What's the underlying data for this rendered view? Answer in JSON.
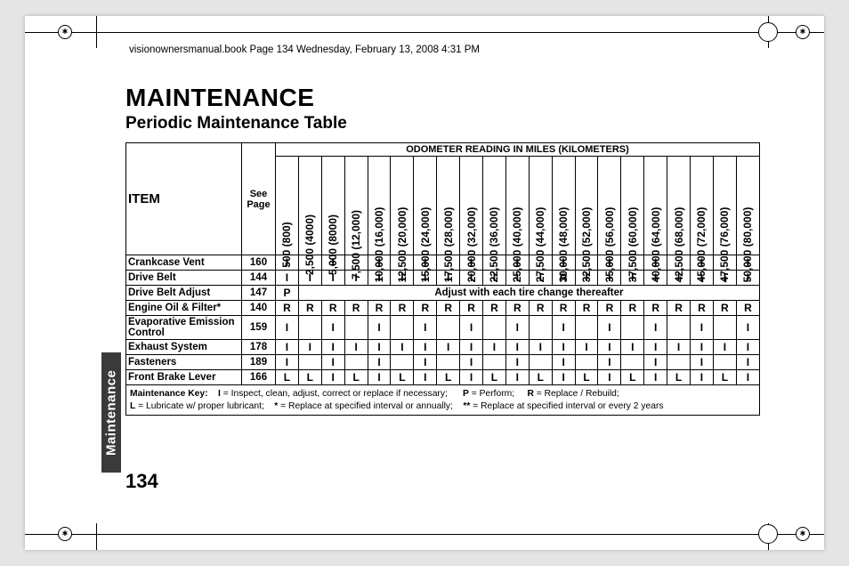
{
  "meta": {
    "header": "visionownersmanual.book  Page 134  Wednesday, February 13, 2008  4:31 PM"
  },
  "title": "MAINTENANCE",
  "subtitle": "Periodic Maintenance Table",
  "side_tab": "Maintenance",
  "page_number": "134",
  "table": {
    "item_head": "ITEM",
    "page_head": "See Page",
    "odometer_head": "ODOMETER READING IN MILES (KILOMETERS)",
    "columns": [
      "500 (800)",
      "2,500 (4000)",
      "5,000 (8000)",
      "7,500 (12,000)",
      "10,000 (16,000)",
      "12,500 (20,000)",
      "15,000 (24,000)",
      "17,500 (28,000)",
      "20,000 (32,000)",
      "22,500 (36,000)",
      "25,000 (40,000)",
      "27,500 (44,000)",
      "30,000 (48,000)",
      "32,500 (52,000)",
      "35,000 (56,000)",
      "37,500 (60,000)",
      "40,000 (64,000)",
      "42,500 (68,000)",
      "45,000 (72,000)",
      "47,500 (76,000)",
      "50,000 (80,000)"
    ],
    "rows": [
      {
        "name": "Crankcase Vent",
        "page": "160",
        "v": [
          "I",
          "",
          "I",
          "",
          "I",
          "",
          "I",
          "",
          "I",
          "",
          "I",
          "",
          "I",
          "",
          "I",
          "",
          "I",
          "",
          "I",
          "",
          "I"
        ]
      },
      {
        "name": "Drive Belt",
        "page": "144",
        "v": [
          "I",
          "I",
          "I",
          "I",
          "I",
          "I",
          "I",
          "I",
          "I",
          "I",
          "I",
          "I",
          "R",
          "I",
          "I",
          "I",
          "I",
          "I",
          "I",
          "I",
          "I"
        ]
      },
      {
        "name": "Drive Belt Adjust",
        "page": "147",
        "adjust_first": "P",
        "adjust_text": "Adjust with each tire change thereafter"
      },
      {
        "name": "Engine Oil & Filter*",
        "page": "140",
        "v": [
          "R",
          "R",
          "R",
          "R",
          "R",
          "R",
          "R",
          "R",
          "R",
          "R",
          "R",
          "R",
          "R",
          "R",
          "R",
          "R",
          "R",
          "R",
          "R",
          "R",
          "R"
        ]
      },
      {
        "name": "Evaporative Emission Control",
        "page": "159",
        "v": [
          "I",
          "",
          "I",
          "",
          "I",
          "",
          "I",
          "",
          "I",
          "",
          "I",
          "",
          "I",
          "",
          "I",
          "",
          "I",
          "",
          "I",
          "",
          "I"
        ]
      },
      {
        "name": "Exhaust System",
        "page": "178",
        "v": [
          "I",
          "I",
          "I",
          "I",
          "I",
          "I",
          "I",
          "I",
          "I",
          "I",
          "I",
          "I",
          "I",
          "I",
          "I",
          "I",
          "I",
          "I",
          "I",
          "I",
          "I"
        ]
      },
      {
        "name": "Fasteners",
        "page": "189",
        "v": [
          "I",
          "",
          "I",
          "",
          "I",
          "",
          "I",
          "",
          "I",
          "",
          "I",
          "",
          "I",
          "",
          "I",
          "",
          "I",
          "",
          "I",
          "",
          "I"
        ]
      },
      {
        "name": "Front Brake Lever",
        "page": "166",
        "v": [
          "L",
          "L",
          "I",
          "L",
          "I",
          "L",
          "I",
          "L",
          "I",
          "L",
          "I",
          "L",
          "I",
          "L",
          "I",
          "L",
          "I",
          "L",
          "I",
          "L",
          "I"
        ]
      }
    ],
    "key": {
      "title": "Maintenance Key:",
      "i": "I",
      "i_def": "= Inspect, clean, adjust, correct or replace if necessary;",
      "p": "P",
      "p_def": "= Perform;",
      "r": "R",
      "r_def": "= Replace / Rebuild;",
      "l": "L",
      "l_def": "= Lubricate w/ proper lubricant;",
      "star": "*",
      "star_def": "= Replace at specified interval or annually;",
      "dstar": "**",
      "dstar_def": "= Replace at specified interval or every 2 years"
    }
  }
}
